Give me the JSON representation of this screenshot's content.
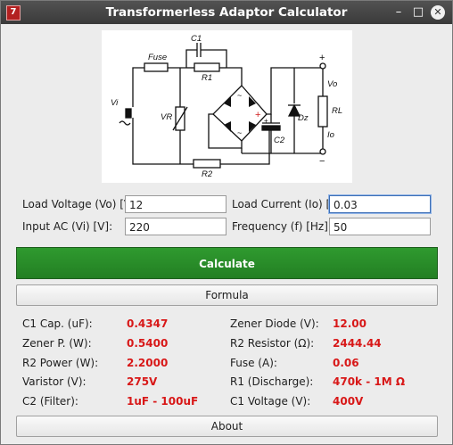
{
  "window": {
    "title": "Transformerless Adaptor Calculator",
    "icon_label": "7",
    "minimize_icon": "–",
    "maximize_icon": "□",
    "close_icon": "✕"
  },
  "diagram": {
    "labels": {
      "c1": "C1",
      "fuse": "Fuse",
      "r1": "R1",
      "vi": "Vi",
      "vr": "VR",
      "c2": "C2",
      "dz": "Dz",
      "rl": "RL",
      "vo": "Vo",
      "io": "Io",
      "r2": "R2",
      "plus": "+",
      "minus": "−",
      "cap_plus": "+",
      "bridge_plus": "+",
      "tilde": "~"
    }
  },
  "inputs": {
    "load_voltage": {
      "label": "Load Voltage (Vo) [V]:",
      "value": "12"
    },
    "load_current": {
      "label": "Load Current (Io) [A]:",
      "value": "0.03"
    },
    "input_ac": {
      "label": "Input AC (Vi) [V]:",
      "value": "220"
    },
    "frequency": {
      "label": "Frequency (f) [Hz]:",
      "value": "50"
    }
  },
  "buttons": {
    "calculate": "Calculate",
    "formula": "Formula",
    "about": "About"
  },
  "colors": {
    "calculate_bg": "#2a8f2a",
    "result_value": "#d81818"
  },
  "results": {
    "left": [
      {
        "label": "C1 Cap. (uF):",
        "value": "0.4347"
      },
      {
        "label": "Zener P. (W):",
        "value": "0.5400"
      },
      {
        "label": "R2 Power (W):",
        "value": "2.2000"
      },
      {
        "label": "Varistor (V):",
        "value": "275V"
      },
      {
        "label": "C2 (Filter):",
        "value": "1uF - 100uF"
      }
    ],
    "right": [
      {
        "label": "Zener Diode (V):",
        "value": "12.00"
      },
      {
        "label": "R2 Resistor (Ω):",
        "value": "2444.44"
      },
      {
        "label": "Fuse (A):",
        "value": "0.06"
      },
      {
        "label": "R1 (Discharge):",
        "value": "470k - 1M Ω"
      },
      {
        "label": "C1 Voltage (V):",
        "value": "400V"
      }
    ]
  }
}
